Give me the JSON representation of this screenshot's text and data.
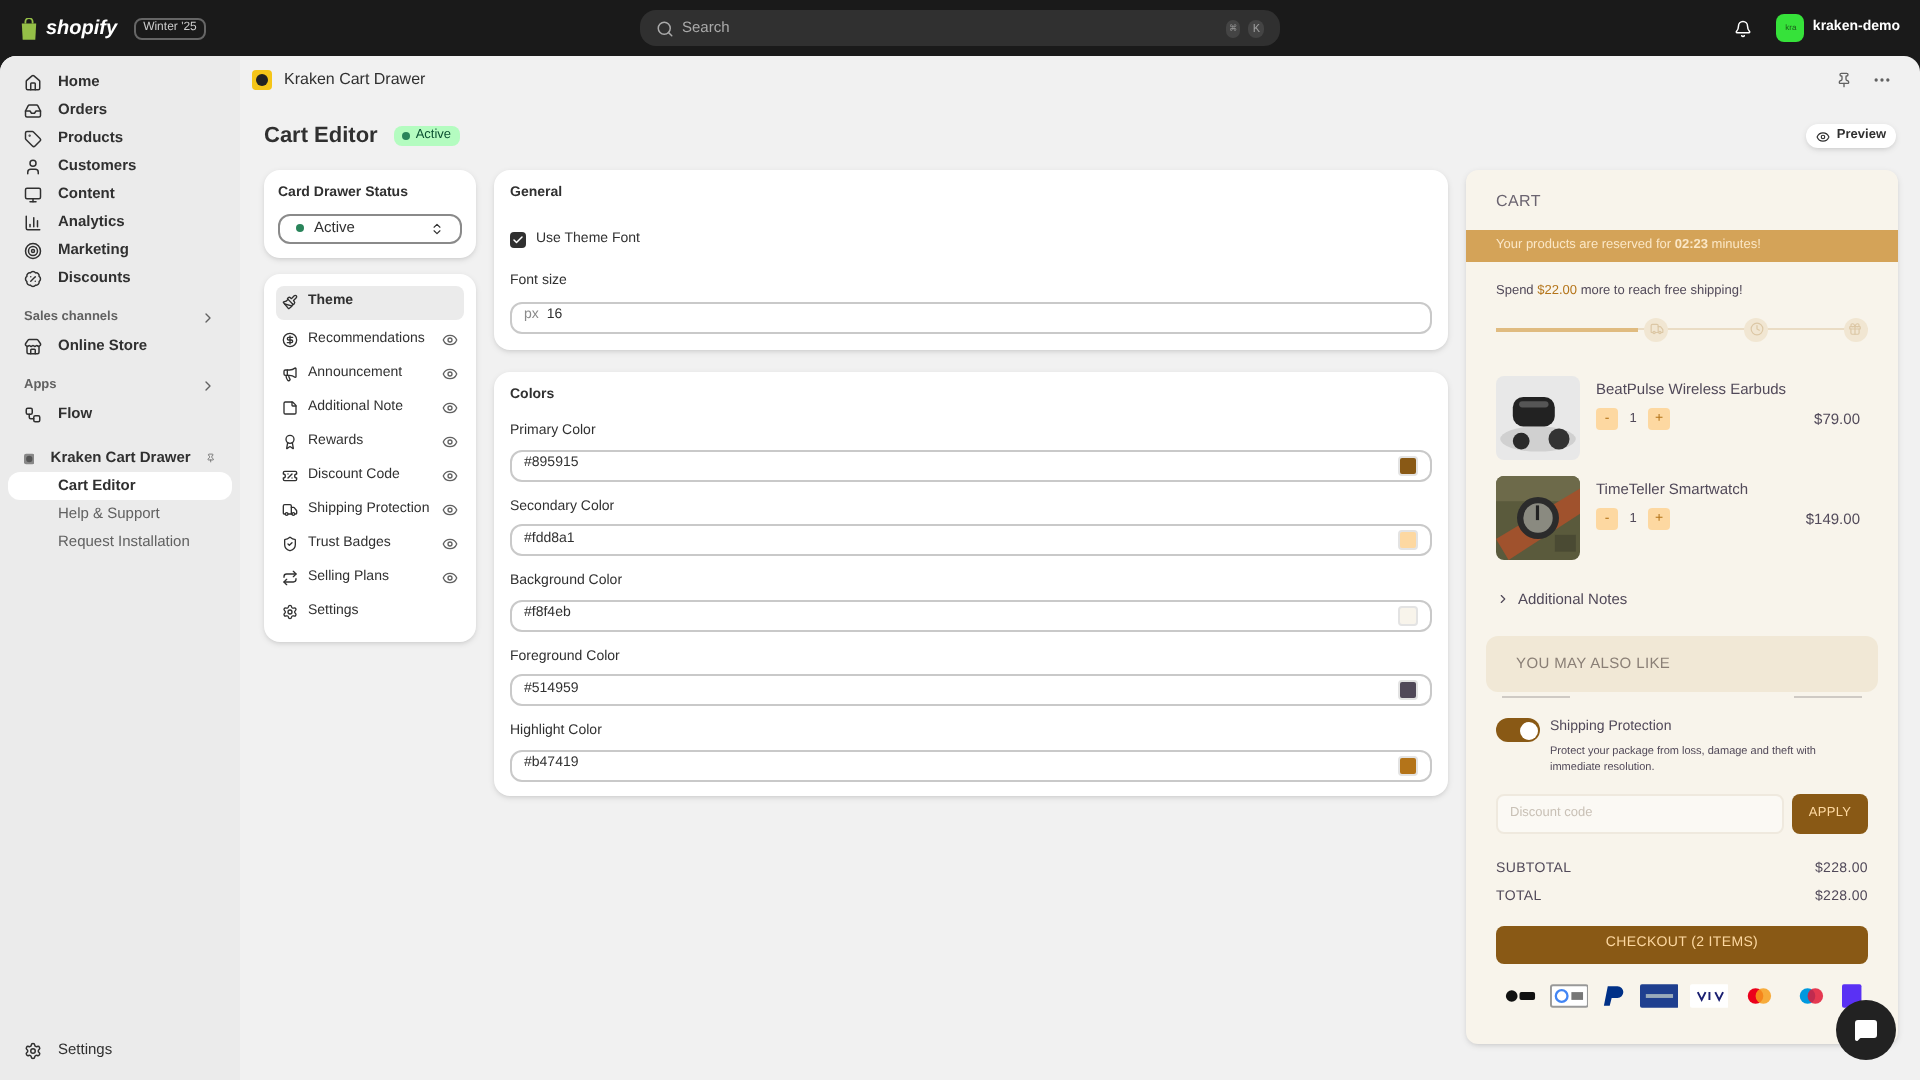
{
  "topbar": {
    "brand": "shopify",
    "edition": "Winter '25",
    "search": {
      "placeholder": "Search",
      "keys": [
        "⌘",
        "K"
      ]
    },
    "avatar": "kra",
    "store": "kraken-demo"
  },
  "sidebar": {
    "nav": [
      {
        "label": "Home",
        "selected": false
      },
      {
        "label": "Orders",
        "selected": false
      },
      {
        "label": "Products",
        "selected": false
      },
      {
        "label": "Customers",
        "selected": false
      },
      {
        "label": "Content",
        "selected": false
      },
      {
        "label": "Analytics",
        "selected": false
      },
      {
        "label": "Marketing",
        "selected": false
      },
      {
        "label": "Discounts",
        "selected": false
      }
    ],
    "sales_channels": {
      "heading": "Sales channels",
      "items": [
        {
          "label": "Online Store",
          "selected": false
        }
      ]
    },
    "apps": {
      "heading": "Apps",
      "items": [
        {
          "label": "Flow",
          "selected": false
        }
      ]
    },
    "pinned_app": {
      "label": "Kraken Cart Drawer",
      "children": [
        {
          "label": "Cart Editor",
          "selected": true
        },
        {
          "label": "Help & Support",
          "selected": false
        },
        {
          "label": "Request Installation",
          "selected": false
        }
      ]
    },
    "settings": "Settings"
  },
  "page": {
    "app_name": "Kraken Cart Drawer",
    "title": "Cart Editor",
    "status": "Active",
    "preview": "Preview"
  },
  "status_card": {
    "title": "Card Drawer Status",
    "value": "Active"
  },
  "menu": [
    {
      "label": "Theme",
      "selected": true,
      "visibility_icon": false
    },
    {
      "label": "Recommendations",
      "selected": false,
      "visibility_icon": true
    },
    {
      "label": "Announcement",
      "selected": false,
      "visibility_icon": true
    },
    {
      "label": "Additional Note",
      "selected": false,
      "visibility_icon": true
    },
    {
      "label": "Rewards",
      "selected": false,
      "visibility_icon": true
    },
    {
      "label": "Discount Code",
      "selected": false,
      "visibility_icon": true
    },
    {
      "label": "Shipping Protection",
      "selected": false,
      "visibility_icon": true
    },
    {
      "label": "Trust Badges",
      "selected": false,
      "visibility_icon": true
    },
    {
      "label": "Selling Plans",
      "selected": false,
      "visibility_icon": true
    },
    {
      "label": "Settings",
      "selected": false,
      "visibility_icon": false
    }
  ],
  "general": {
    "heading": "General",
    "checkbox": {
      "label": "Use Theme Font",
      "checked": true
    },
    "font_size": {
      "label": "Font size",
      "unit": "px",
      "value": "16"
    }
  },
  "colors": {
    "heading": "Colors",
    "fields": [
      {
        "label": "Primary Color",
        "value": "#895915",
        "color": "#895915"
      },
      {
        "label": "Secondary Color",
        "value": "#fdd8a1",
        "color": "#fdd8a1"
      },
      {
        "label": "Background Color",
        "value": "#f8f4eb",
        "color": "#f8f4eb"
      },
      {
        "label": "Foreground Color",
        "value": "#514959",
        "color": "#514959"
      },
      {
        "label": "Highlight Color",
        "value": "#b47419",
        "color": "#b47419"
      }
    ]
  },
  "cart": {
    "title": "CART",
    "reservation": "Your products are reserved for **02:23** minutes!",
    "shipping": {
      "before": "Spend",
      "amount": "$22.00",
      "after": "more to reach free shipping!",
      "level": 0.38
    },
    "items": [
      {
        "name": "BeatPulse Wireless Earbuds",
        "minus": "-",
        "quantity": "1",
        "plus": "+",
        "price": "$79.00"
      },
      {
        "name": "TimeTeller Smartwatch",
        "minus": "-",
        "quantity": "1",
        "plus": "+",
        "price": "$149.00"
      }
    ],
    "notes": "Additional Notes",
    "upsell": "YOU MAY ALSO LIKE",
    "protection": {
      "title": "Shipping Protection",
      "description": "Protect your package from loss, damage and theft with immediate resolution.",
      "on": true
    },
    "discount": {
      "placeholder": "Discount code",
      "button": "APPLY"
    },
    "totals": [
      {
        "label": "SUBTOTAL",
        "value": "$228.00"
      },
      {
        "label": "TOTAL",
        "value": "$228.00"
      }
    ],
    "checkout": "CHECKOUT (2 ITEMS)"
  }
}
